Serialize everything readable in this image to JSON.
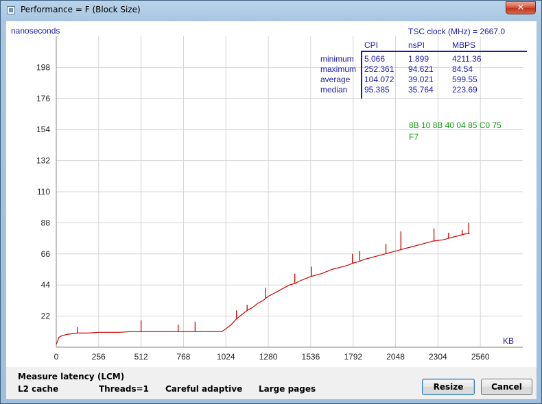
{
  "window": {
    "title": "Performance = F (Block Size)",
    "close_glyph": "✕"
  },
  "chart_data": {
    "type": "line",
    "ylabel": "nanoseconds",
    "xlabel": "KB",
    "x_ticks": [
      0,
      256,
      512,
      768,
      1024,
      1280,
      1536,
      1792,
      2048,
      2304,
      2560
    ],
    "y_ticks": [
      22,
      44,
      66,
      88,
      110,
      132,
      154,
      176,
      198
    ],
    "xlim": [
      0,
      2816
    ],
    "ylim": [
      0,
      220
    ],
    "grid": true,
    "line_color": "#cc0000",
    "series": [
      {
        "x": [
          0,
          16,
          32,
          64,
          96,
          128,
          192,
          256,
          320,
          384,
          448,
          512,
          576,
          640,
          704,
          768,
          832,
          896,
          960,
          1000,
          1024,
          1056,
          1088,
          1120,
          1152,
          1184,
          1216,
          1248,
          1280,
          1312,
          1344,
          1376,
          1408,
          1440,
          1472,
          1504,
          1536,
          1568,
          1600,
          1632,
          1664,
          1696,
          1728,
          1760,
          1792,
          1824,
          1856,
          1888,
          1920,
          1952,
          1984,
          2016,
          2048,
          2080,
          2112,
          2144,
          2176,
          2208,
          2240,
          2272,
          2304,
          2336,
          2368,
          2400,
          2432,
          2464,
          2496
        ],
        "y": [
          2,
          7,
          8,
          9,
          9.5,
          10,
          10,
          10.5,
          10.5,
          10.5,
          11,
          11,
          11,
          11,
          11,
          11,
          11,
          11,
          11,
          11,
          13,
          16,
          20,
          23,
          26,
          28,
          31,
          33,
          36,
          38,
          40,
          42,
          44,
          45,
          47,
          48.5,
          50,
          51,
          52,
          53.5,
          55,
          56,
          57,
          58,
          59.5,
          60.5,
          62,
          63,
          64,
          65,
          66,
          67,
          68,
          69,
          70,
          71,
          72,
          73,
          74,
          75,
          75.5,
          76,
          77,
          78,
          79,
          80,
          80.5
        ]
      }
    ],
    "spikes": [
      {
        "x": 128,
        "y": 14
      },
      {
        "x": 512,
        "y": 19
      },
      {
        "x": 736,
        "y": 16
      },
      {
        "x": 838,
        "y": 18
      },
      {
        "x": 1088,
        "y": 26
      },
      {
        "x": 1152,
        "y": 30
      },
      {
        "x": 1264,
        "y": 42
      },
      {
        "x": 1440,
        "y": 52
      },
      {
        "x": 1540,
        "y": 57
      },
      {
        "x": 1788,
        "y": 66
      },
      {
        "x": 1832,
        "y": 68
      },
      {
        "x": 1990,
        "y": 73
      },
      {
        "x": 2080,
        "y": 82
      },
      {
        "x": 2280,
        "y": 84
      },
      {
        "x": 2368,
        "y": 81
      },
      {
        "x": 2450,
        "y": 83
      },
      {
        "x": 2490,
        "y": 88
      }
    ],
    "stats": {
      "columns": [
        "CPI",
        "nsPI",
        "MBPS"
      ],
      "rows": [
        {
          "label": "minimum",
          "values": [
            "5.066",
            "1.899",
            "4211.36"
          ]
        },
        {
          "label": "maximum",
          "values": [
            "252.361",
            "94.621",
            "84.54"
          ]
        },
        {
          "label": "average",
          "values": [
            "104.072",
            "39.021",
            "599.55"
          ]
        },
        {
          "label": "median",
          "values": [
            "95.385",
            "35.764",
            "223.69"
          ]
        }
      ]
    },
    "tsc_label": "TSC clock (MHz)  = 2667.0",
    "hex_line1": "8B  10  8B  40  04  85  C0  75",
    "hex_line2": "F7",
    "colors": {
      "axis_text": "#202020",
      "grid": "#d4d4d4",
      "info_blue": "#1b1bb0",
      "hex_green": "#119911"
    }
  },
  "status": {
    "mode": "Measure latency (LCM)",
    "target": "L2 cache",
    "threads": "Threads=1",
    "method": "Careful adaptive",
    "pages": "Large pages"
  },
  "buttons": {
    "resize": "Resize",
    "cancel": "Cancel"
  }
}
